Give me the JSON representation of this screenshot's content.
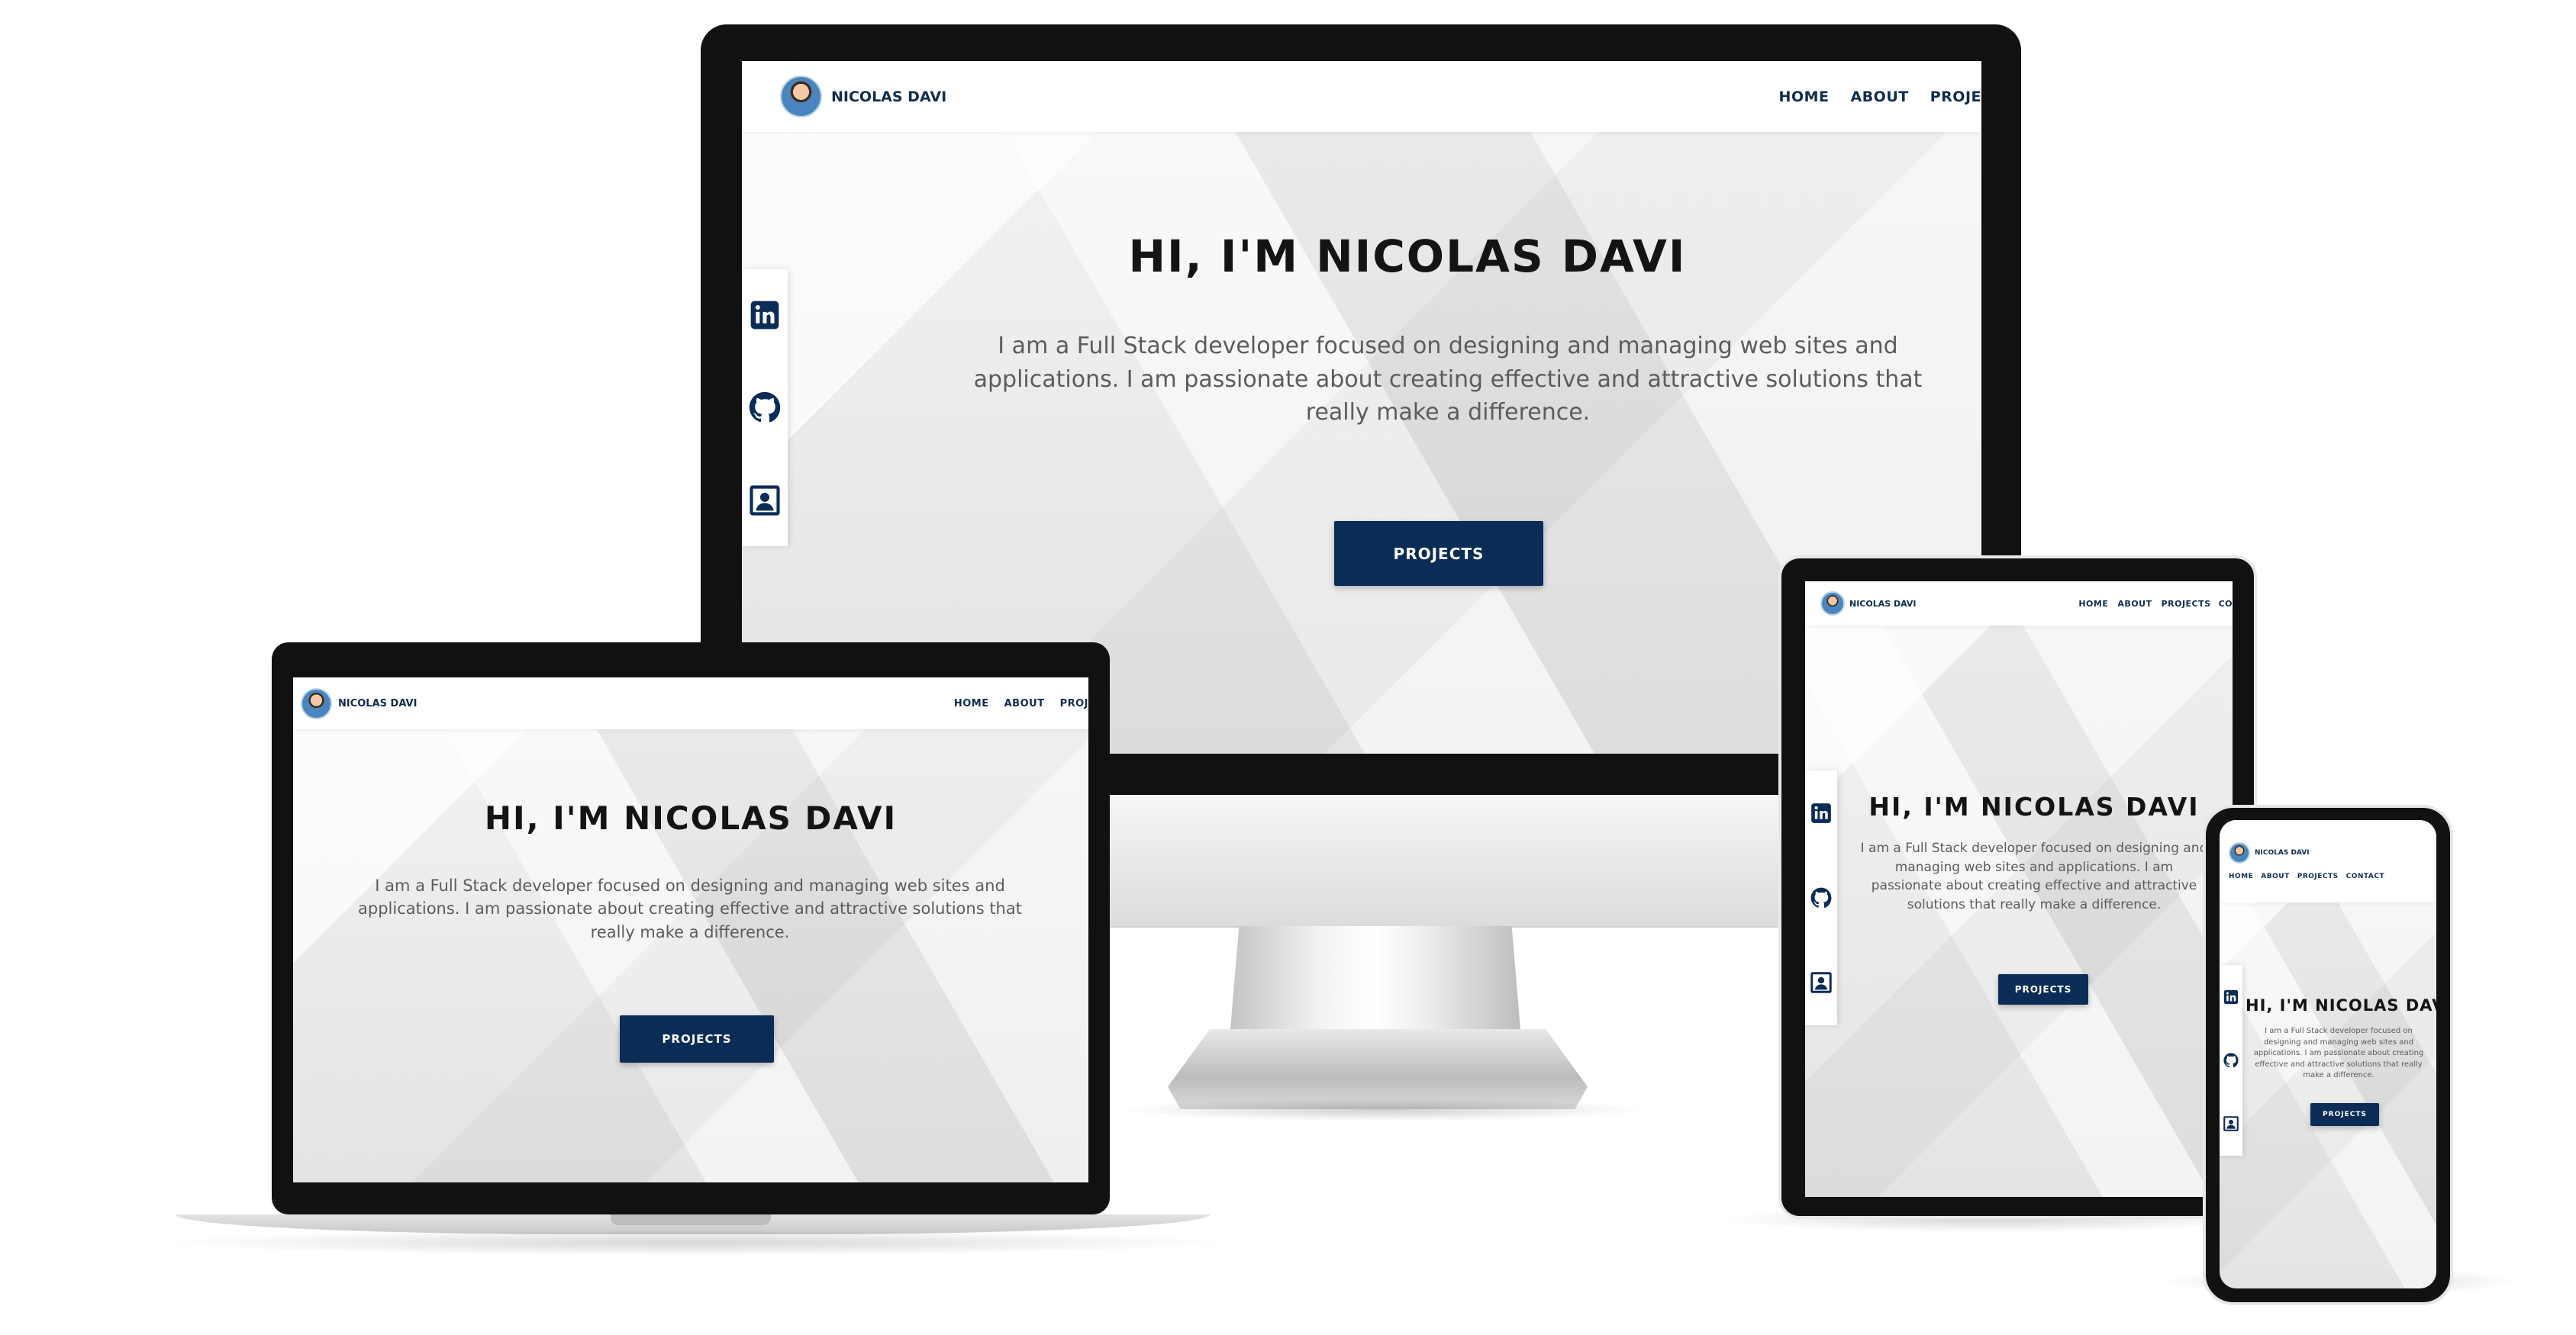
{
  "site": {
    "brand": "NICOLAS DAVI",
    "menu": [
      "HOME",
      "ABOUT",
      "PROJECTS",
      "CONTACT"
    ],
    "menu_clipped_large": [
      "HOME",
      "ABOUT",
      "PROJE"
    ],
    "menu_clipped_laptop": [
      "HOME",
      "ABOUT",
      "PROJ"
    ],
    "menu_clipped_tablet": [
      "HOME",
      "ABOUT",
      "PROJECTS",
      "CO"
    ],
    "hero_title": "HI, I'M NICOLAS DAVI",
    "hero_text": "I am a Full Stack developer focused on designing and managing web sites and applications. I am passionate about creating effective and attractive solutions that really make a difference.",
    "cta_label": "PROJECTS",
    "social_icons": [
      "linkedin-icon",
      "github-icon",
      "contact-card-icon"
    ]
  },
  "colors": {
    "brand_navy": "#0a2c57",
    "text_dark": "#141414",
    "device_frame": "#111111"
  }
}
